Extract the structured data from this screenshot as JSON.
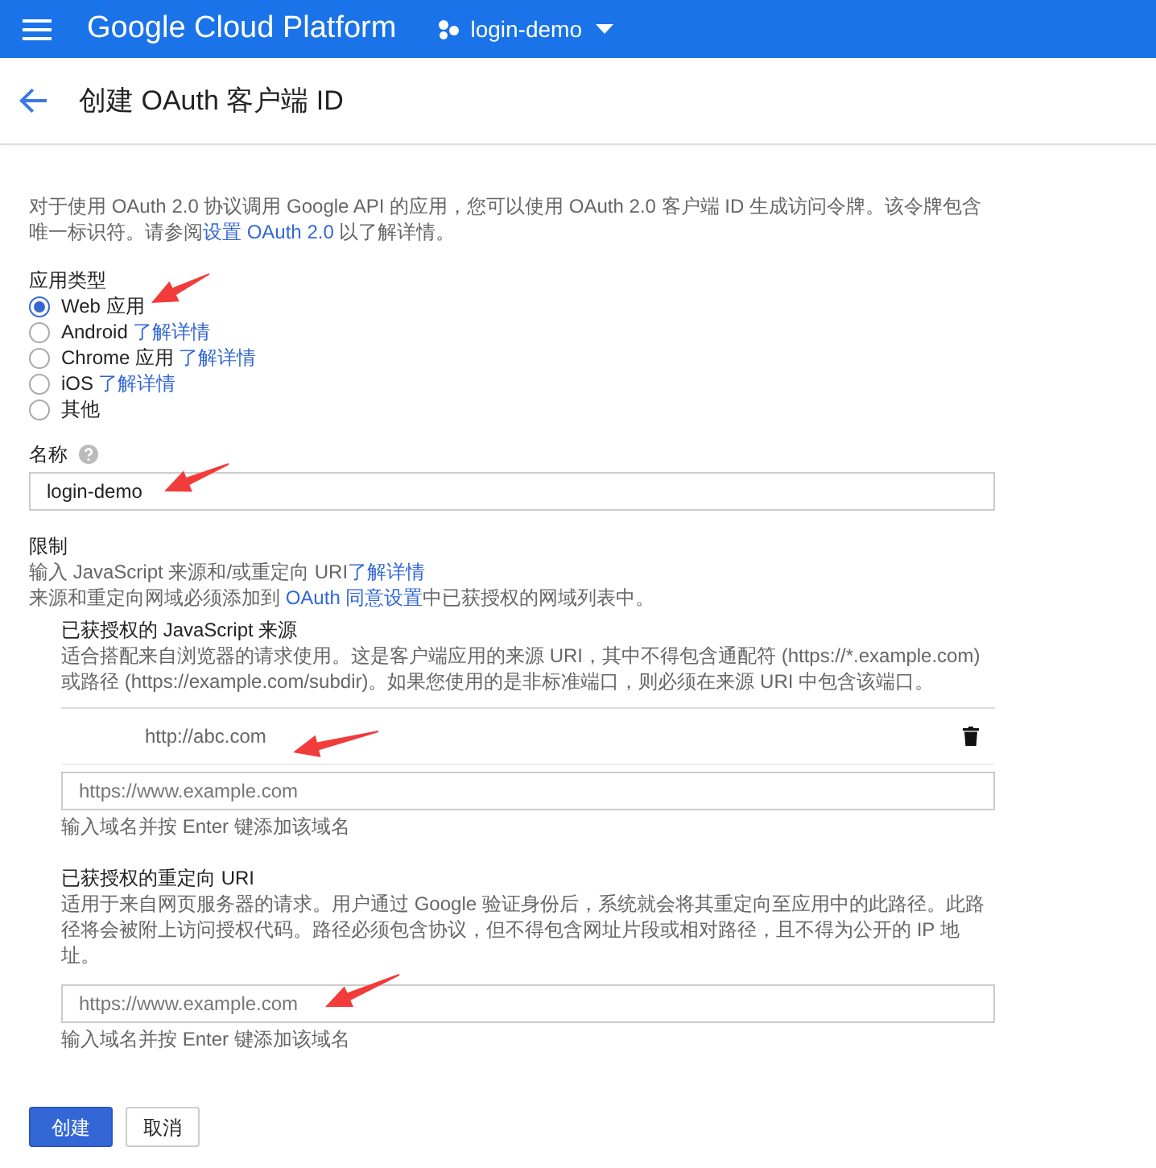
{
  "header": {
    "title": "Google Cloud Platform",
    "project": "login-demo"
  },
  "page_title": "创建 OAuth 客户端 ID",
  "intro": {
    "text": "对于使用 OAuth 2.0 协议调用 Google API 的应用，您可以使用 OAuth 2.0 客户端 ID 生成访问令牌。该令牌包含唯一标识符。请参阅",
    "link": "设置 OAuth 2.0",
    "after": " 以了解详情。"
  },
  "app_type": {
    "label": "应用类型",
    "options": [
      {
        "label": "Web 应用",
        "selected": true
      },
      {
        "label": "Android",
        "link": "了解详情",
        "selected": false
      },
      {
        "label": "Chrome 应用",
        "link": "了解详情",
        "selected": false
      },
      {
        "label": "iOS",
        "link": "了解详情",
        "selected": false
      },
      {
        "label": "其他",
        "selected": false
      }
    ]
  },
  "name": {
    "label": "名称",
    "value": "login-demo"
  },
  "restrictions": {
    "label": "限制",
    "hint": "输入 JavaScript 来源和/或重定向 URI",
    "hint_link": "了解详情",
    "note": "来源和重定向网域必须添加到 ",
    "note_link": "OAuth 同意设置",
    "note_after": "中已获授权的网域列表中。"
  },
  "js_origins": {
    "title": "已获授权的 JavaScript 来源",
    "description": "适合搭配来自浏览器的请求使用。这是客户端应用的来源 URI，其中不得包含通配符 (https://*.example.com) 或路径 (https://example.com/subdir)。如果您使用的是非标准端口，则必须在来源 URI 中包含该端口。",
    "entries": [
      "http://abc.com"
    ],
    "placeholder": "https://www.example.com",
    "help": "输入域名并按 Enter 键添加该域名"
  },
  "redirect_uris": {
    "title": "已获授权的重定向 URI",
    "description": "适用于来自网页服务器的请求。用户通过 Google 验证身份后，系统就会将其重定向至应用中的此路径。此路径将会被附上访问授权代码。路径必须包含协议，但不得包含网址片段或相对路径，且不得为公开的 IP 地址。",
    "placeholder": "https://www.example.com",
    "help": "输入域名并按 Enter 键添加该域名"
  },
  "buttons": [
    {
      "label": "创建",
      "kind": "primary"
    },
    {
      "label": "取消",
      "kind": "secondary"
    }
  ]
}
